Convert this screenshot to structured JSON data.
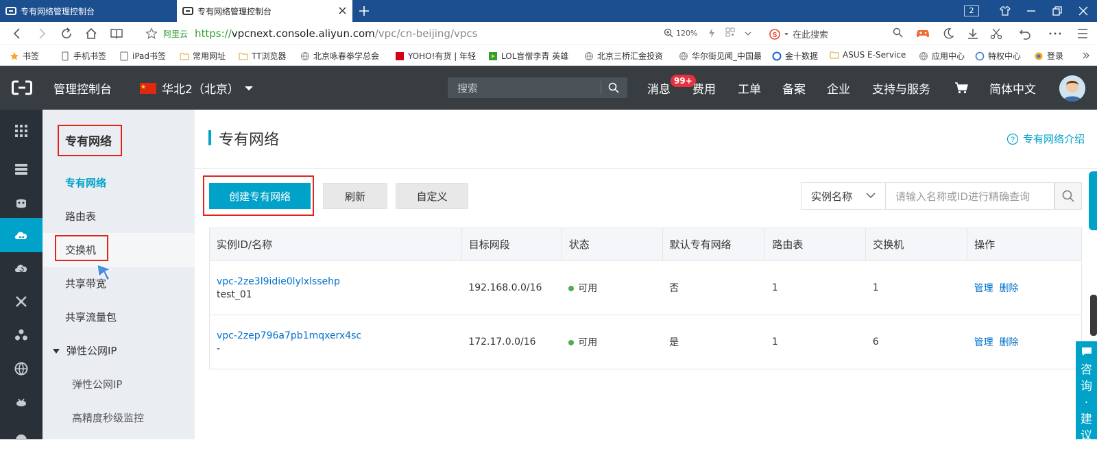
{
  "browser": {
    "tabs": [
      {
        "title": "专有网络管理控制台"
      },
      {
        "title": "专有网络管理控制台"
      }
    ],
    "tab_count": "2",
    "site_tag": "阿里云",
    "url_scheme": "https://",
    "url_host": "vpcnext.console.aliyun.com",
    "url_path": "/vpc/cn-beijing/vpcs",
    "zoom": "120%",
    "search_placeholder": "在此搜索",
    "bookmarks": [
      "书签",
      "手机书签",
      "iPad书签",
      "常用网址",
      "TT浏览器",
      "北京咏春拳学总会",
      "YOHO!有货 | 年轻",
      "LOL盲僧李青 英雄",
      "北京三桥汇金投资",
      "华尔街见闻_中国最",
      "金十数据",
      "ASUS E-Service",
      "应用中心",
      "特权中心",
      "登录"
    ]
  },
  "header": {
    "title": "管理控制台",
    "region": "华北2（北京）",
    "search_placeholder": "搜索",
    "messages": "消息",
    "badge": "99+",
    "nav": [
      "费用",
      "工单",
      "备案",
      "企业",
      "支持与服务"
    ],
    "language": "简体中文"
  },
  "sidebar": {
    "title": "专有网络",
    "items": [
      {
        "label": "专有网络"
      },
      {
        "label": "路由表"
      },
      {
        "label": "交换机"
      },
      {
        "label": "共享带宽"
      },
      {
        "label": "共享流量包"
      },
      {
        "label": "弹性公网IP"
      },
      {
        "label": "弹性公网IP"
      },
      {
        "label": "高精度秒级监控"
      }
    ]
  },
  "main": {
    "title": "专有网络",
    "intro_link": "专有网络介绍",
    "create_button": "创建专有网络",
    "refresh_button": "刷新",
    "custom_button": "自定义",
    "filter_select": "实例名称",
    "filter_placeholder": "请输入名称或ID进行精确查询",
    "table": {
      "headers": [
        "实例ID/名称",
        "目标网段",
        "状态",
        "默认专有网络",
        "路由表",
        "交换机",
        "操作"
      ],
      "rows": [
        {
          "id": "vpc-2ze3l9idie0lylxlssehp",
          "name": "test_01",
          "cidr": "192.168.0.0/16",
          "status": "可用",
          "default": "否",
          "route_tables": "1",
          "switches": "1",
          "manage": "管理",
          "delete": "删除"
        },
        {
          "id": "vpc-2zep796a7pb1mqxerx4sc",
          "name": "-",
          "cidr": "172.17.0.0/16",
          "status": "可用",
          "default": "是",
          "route_tables": "1",
          "switches": "6",
          "manage": "管理",
          "delete": "删除"
        }
      ]
    }
  },
  "float": {
    "consult": "咨询·建议"
  },
  "colors": {
    "accent": "#00a2ca",
    "header_bg": "#373d41",
    "iconbar_bg": "#293038",
    "highlight_box": "#e2231a",
    "link": "#0070cc",
    "status_ok": "#4cae4c"
  }
}
